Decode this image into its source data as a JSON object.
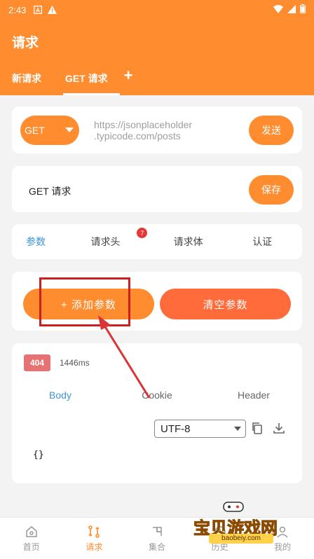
{
  "status_bar": {
    "time": "2:43"
  },
  "app": {
    "title": "请求"
  },
  "tabs": [
    {
      "label": "新请求"
    },
    {
      "label": "GET 请求"
    }
  ],
  "tab_add": "+",
  "request": {
    "method": "GET",
    "url_line1": "https://jsonplaceholder",
    "url_line2": ".typicode.com/posts",
    "send_label": "发送",
    "name": "GET 请求",
    "save_label": "保存"
  },
  "param_tabs": [
    {
      "label": "参数"
    },
    {
      "label": "请求头",
      "badge": "7"
    },
    {
      "label": "请求体"
    },
    {
      "label": "认证"
    }
  ],
  "actions": {
    "add": "+ 添加参数",
    "clear": "清空参数"
  },
  "response": {
    "status": "404",
    "time": "1446ms",
    "tabs": [
      "Body",
      "Cookie",
      "Header"
    ],
    "encoding": "UTF-8",
    "body": "{}"
  },
  "bottom_nav": [
    {
      "label": "首页",
      "icon": "home-icon"
    },
    {
      "label": "请求",
      "icon": "request-icon"
    },
    {
      "label": "集合",
      "icon": "collection-icon"
    },
    {
      "label": "历史",
      "icon": "history-icon"
    },
    {
      "label": "我的",
      "icon": "user-icon"
    }
  ],
  "watermark": {
    "text": "宝贝游戏网",
    "url": "baobeiy.com"
  },
  "colors": {
    "accent": "#ff8c2e",
    "clear_button": "#ff6b3a",
    "link_blue": "#3e95d6",
    "error_badge": "#e57373",
    "highlight_box": "#cc2020"
  }
}
